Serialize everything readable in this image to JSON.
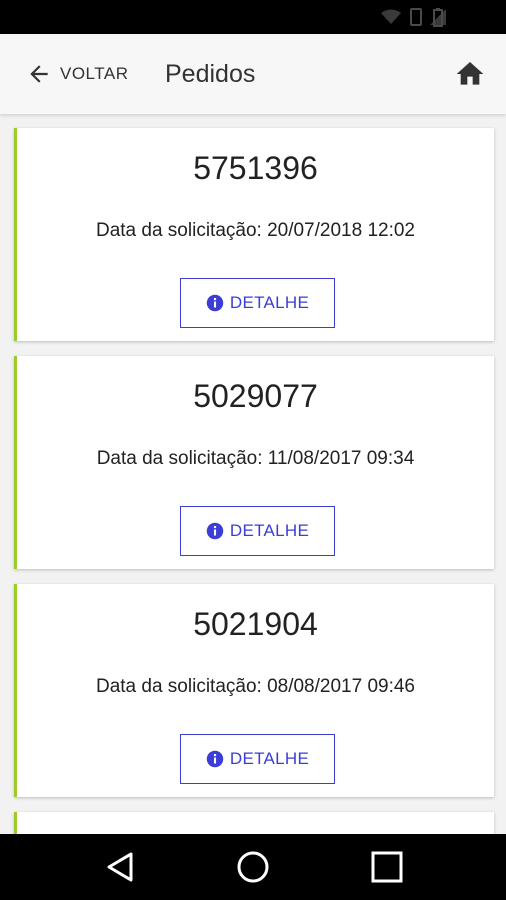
{
  "header": {
    "back_label": "VOLTAR",
    "title": "Pedidos"
  },
  "orders": [
    {
      "number": "5751396",
      "date_text": "Data da solicitação: 20/07/2018 12:02",
      "button_label": "DETALHE"
    },
    {
      "number": "5029077",
      "date_text": "Data da solicitação: 11/08/2017 09:34",
      "button_label": "DETALHE"
    },
    {
      "number": "5021904",
      "date_text": "Data da solicitação: 08/08/2017 09:46",
      "button_label": "DETALHE"
    }
  ],
  "icons": {
    "back": "arrow-left-icon",
    "home": "home-icon",
    "info": "info-icon",
    "nav_back": "triangle-back-icon",
    "nav_home": "circle-home-icon",
    "nav_recent": "square-recent-icon"
  },
  "colors": {
    "accent_border": "#9ccc2a",
    "button_blue": "#3b3dd6",
    "app_bar_bg": "#f7f7f7",
    "page_bg": "#f2f2f2"
  }
}
